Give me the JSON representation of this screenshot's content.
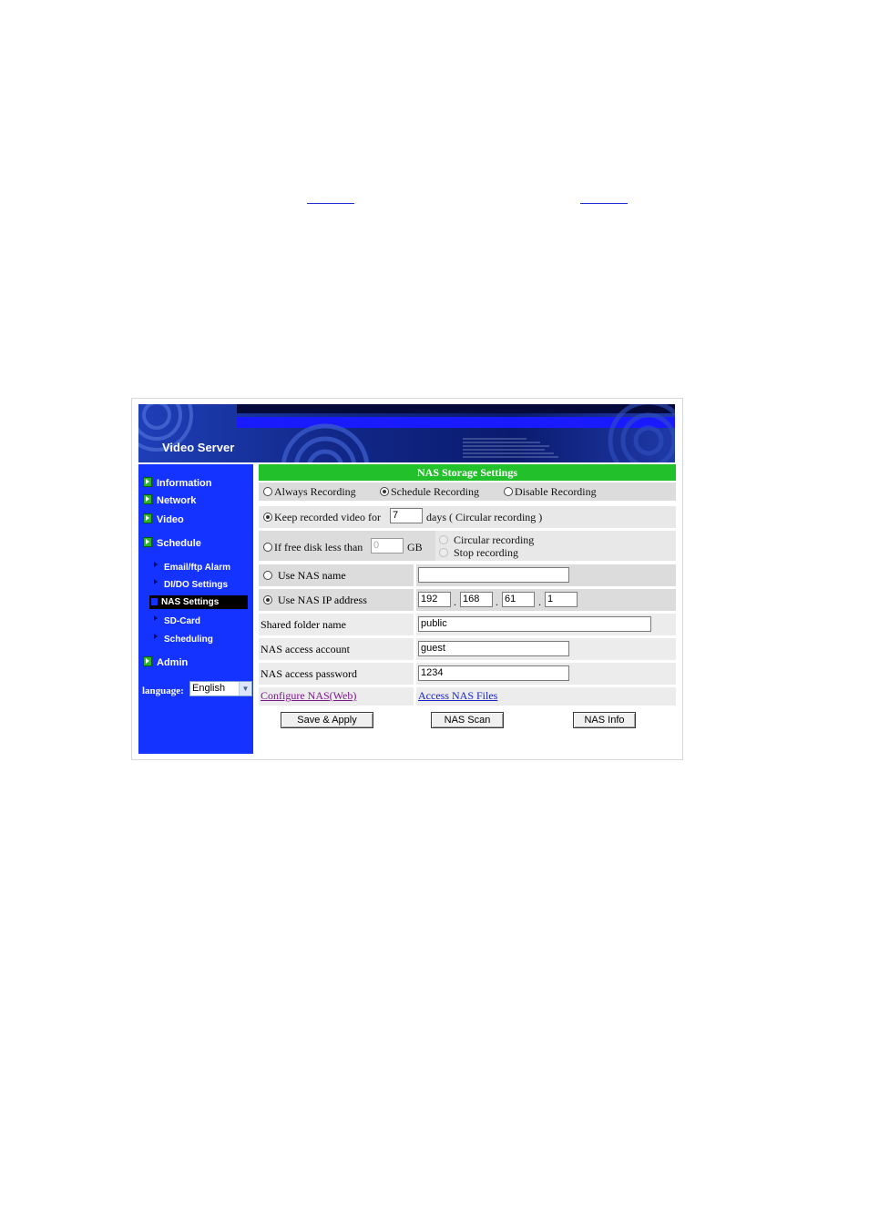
{
  "colors": {
    "sidebar_bg": "#1433ff",
    "header_green": "#22c02a",
    "row_gray": "#dcdcdc",
    "link_blue": "#1a22c8",
    "link_visited": "#7a1a8a"
  },
  "banner": {
    "title": "Video Server"
  },
  "sidebar": {
    "items": [
      {
        "label": "Information",
        "icon": "green-arrow-icon"
      },
      {
        "label": "Network",
        "icon": "green-arrow-icon"
      },
      {
        "label": "Video",
        "icon": "green-arrow-icon"
      },
      {
        "label": "Schedule",
        "icon": "green-arrow-icon"
      }
    ],
    "subitems": [
      {
        "label": "Email/ftp Alarm"
      },
      {
        "label": "DI/DO Settings"
      },
      {
        "label": "NAS Settings",
        "active": true
      },
      {
        "label": "SD-Card"
      },
      {
        "label": "Scheduling"
      }
    ],
    "admin": {
      "label": "Admin",
      "icon": "green-arrow-icon"
    },
    "language": {
      "label": "language:",
      "value": "English"
    }
  },
  "main": {
    "title": "NAS Storage Settings",
    "mode": {
      "options": [
        "Always Recording",
        "Schedule Recording",
        "Disable Recording"
      ],
      "selected": "Schedule Recording"
    },
    "keep": {
      "label": "Keep recorded video for",
      "value": "7",
      "suffix": "days ( Circular recording )",
      "selected": true
    },
    "free_disk": {
      "label": "If free disk less than",
      "value": "0",
      "unit": "GB",
      "options": [
        "Circular recording",
        "Stop recording"
      ]
    },
    "nas_name": {
      "label": "Use NAS name",
      "value": ""
    },
    "nas_ip": {
      "label": "Use NAS IP address",
      "octets": [
        "192",
        "168",
        "61",
        "1"
      ],
      "separator": ".",
      "selected": true
    },
    "shared_folder": {
      "label": "Shared folder name",
      "value": "public"
    },
    "account": {
      "label": "NAS access account",
      "value": "guest"
    },
    "password": {
      "label": "NAS access password",
      "value": "1234"
    },
    "links": {
      "configure": "Configure NAS(Web)",
      "access": "Access NAS Files"
    },
    "buttons": {
      "save": "Save & Apply",
      "scan": "NAS Scan",
      "info": "NAS Info"
    }
  }
}
